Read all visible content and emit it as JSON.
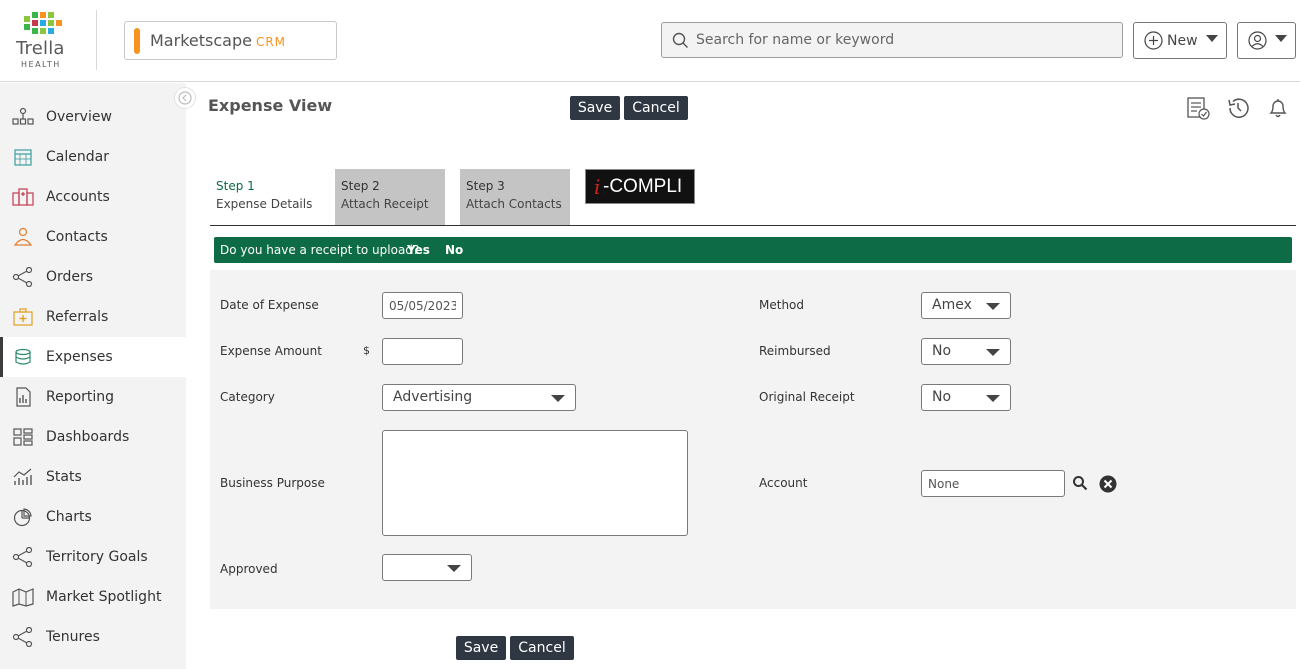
{
  "header": {
    "logo_word": "Trella",
    "logo_sub": "HEALTH",
    "app_name": "Marketscape",
    "app_suffix": "CRM",
    "search_placeholder": "Search for name or keyword",
    "new_label": "New"
  },
  "sidebar": {
    "items": [
      {
        "label": "Overview",
        "icon": "overview-icon",
        "color": "#555555"
      },
      {
        "label": "Calendar",
        "icon": "calendar-icon",
        "color": "#3a9fa0"
      },
      {
        "label": "Accounts",
        "icon": "accounts-icon",
        "color": "#c23b4e"
      },
      {
        "label": "Contacts",
        "icon": "contacts-icon",
        "color": "#e47d2e"
      },
      {
        "label": "Orders",
        "icon": "orders-icon",
        "color": "#555555"
      },
      {
        "label": "Referrals",
        "icon": "referrals-icon",
        "color": "#e0a020"
      },
      {
        "label": "Expenses",
        "icon": "expenses-icon",
        "color": "#2b8a6b"
      },
      {
        "label": "Reporting",
        "icon": "reporting-icon",
        "color": "#555555"
      },
      {
        "label": "Dashboards",
        "icon": "dashboards-icon",
        "color": "#555555"
      },
      {
        "label": "Stats",
        "icon": "stats-icon",
        "color": "#555555"
      },
      {
        "label": "Charts",
        "icon": "charts-icon",
        "color": "#555555"
      },
      {
        "label": "Territory Goals",
        "icon": "territory-goals-icon",
        "color": "#555555"
      },
      {
        "label": "Market Spotlight",
        "icon": "market-spotlight-icon",
        "color": "#555555"
      },
      {
        "label": "Tenures",
        "icon": "tenures-icon",
        "color": "#555555"
      }
    ],
    "active": "Expenses"
  },
  "main": {
    "title": "Expense View",
    "save_label": "Save",
    "cancel_label": "Cancel",
    "tabs": [
      {
        "step": "Step 1",
        "label": "Expense Details"
      },
      {
        "step": "Step 2",
        "label": "Attach Receipt"
      },
      {
        "step": "Step 3",
        "label": "Attach Contacts"
      }
    ],
    "icompli_i": "i",
    "icompli_rest": "-COMPLI",
    "banner": {
      "question": "Do you have a receipt to upload?",
      "yes": "Yes",
      "no": "No"
    },
    "form": {
      "date_label": "Date of Expense",
      "date_value": "05/05/2023",
      "amount_label": "Expense Amount",
      "currency": "$",
      "amount_value": "",
      "category_label": "Category",
      "category_value": "Advertising",
      "purpose_label": "Business Purpose",
      "purpose_value": "",
      "approved_label": "Approved",
      "approved_value": "",
      "method_label": "Method",
      "method_value": "Amex",
      "reimbursed_label": "Reimbursed",
      "reimbursed_value": "No",
      "original_label": "Original Receipt",
      "original_value": "No",
      "account_label": "Account",
      "account_value": "None"
    }
  },
  "colors": {
    "accent_green": "#0d6b45",
    "dark_button": "#2f3842",
    "app_orange": "#f7931e"
  }
}
